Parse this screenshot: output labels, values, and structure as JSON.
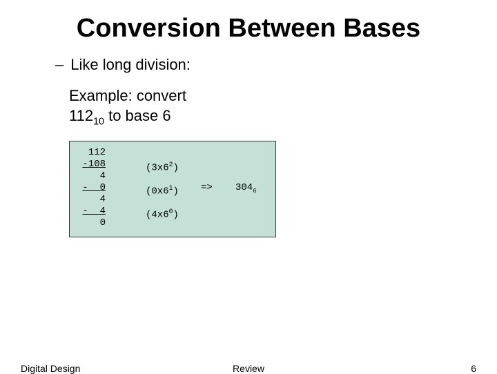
{
  "title": "Conversion Between Bases",
  "bullet": {
    "dash": "–",
    "text": "Like long division:"
  },
  "example": {
    "prefix": "Example: convert",
    "number": "112",
    "number_sub": "10",
    "suffix": " to base 6"
  },
  "calc": {
    "lines": [
      " 112",
      "-108",
      "   4",
      "-  0",
      "   4",
      "-  4",
      "   0"
    ],
    "annot": [
      {
        "base": "(3x6",
        "exp": "2",
        "tail": ")"
      },
      {
        "base": "(0x6",
        "exp": "1",
        "tail": ")"
      },
      {
        "base": "(4x6",
        "exp": "0",
        "tail": ")"
      }
    ],
    "arrow": "=>",
    "result": {
      "digits": "304",
      "sub": "6"
    }
  },
  "footer": {
    "left": "Digital Design",
    "center": "Review",
    "right": "6"
  }
}
